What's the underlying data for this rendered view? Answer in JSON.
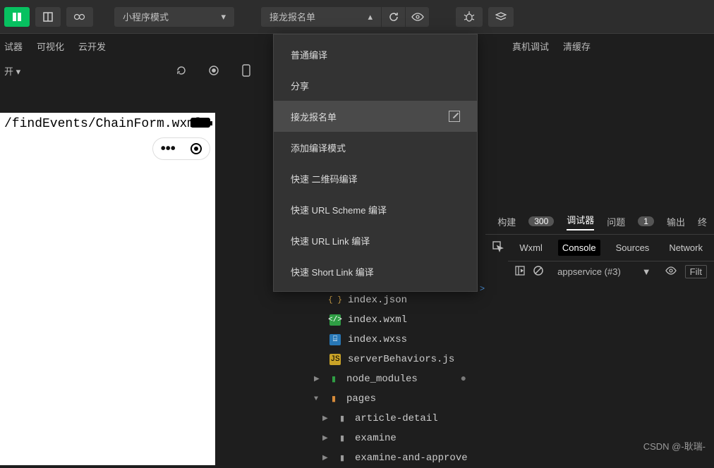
{
  "toolbar": {
    "mode_select": "小程序模式",
    "compile_select": "接龙报名单",
    "right_tool1": "真机调试",
    "right_tool2": "清缓存"
  },
  "tabs_left": {
    "a": "试器",
    "b": "可视化",
    "c": "云开发"
  },
  "secondbar_label": "开 ▾",
  "preview_path": "/findEvents/ChainForm.wxml",
  "menu": {
    "item0": "普通编译",
    "item1": "分享",
    "item2": "接龙报名单",
    "item3": "添加编译模式",
    "item4": "快速 二维码编译",
    "item5": "快速 URL Scheme 编译",
    "item6": "快速 URL Link 编译",
    "item7": "快速 Short Link 编译"
  },
  "tree": {
    "f0": "index.json",
    "f1": "index.wxml",
    "f2": "index.wxss",
    "f3": "serverBehaviors.js",
    "d0": "node_modules",
    "d1": "pages",
    "d2": "article-detail",
    "d3": "examine",
    "d4": "examine-and-approve"
  },
  "devtabs": {
    "build": "构建",
    "build_badge": "300",
    "debugger": "调试器",
    "issues": "问题",
    "issues_badge": "1",
    "output": "输出",
    "terminal": "终"
  },
  "devinner": {
    "wxml": "Wxml",
    "console": "Console",
    "sources": "Sources",
    "network": "Network"
  },
  "devctl": {
    "context": "appservice (#3)",
    "filter": "Filt"
  },
  "prompt": ">",
  "watermark": "CSDN @-耿瑞-"
}
